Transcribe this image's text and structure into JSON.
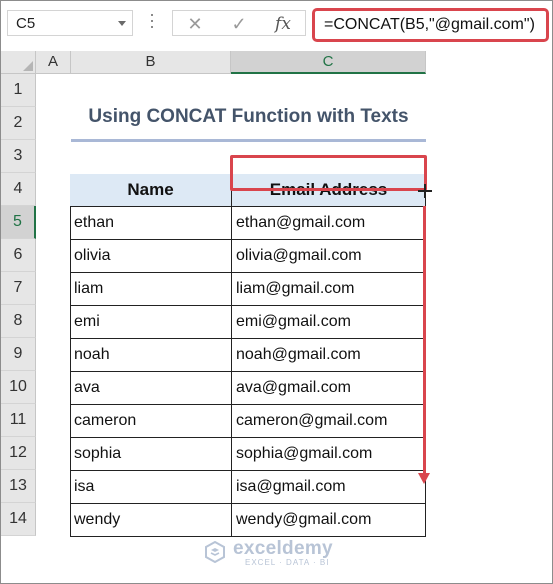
{
  "formula_bar": {
    "name_box": "C5",
    "cancel_icon": "✕",
    "enter_icon": "✓",
    "fx_label": "fx",
    "formula": "=CONCAT(B5,\"@gmail.com\")"
  },
  "columns": [
    "A",
    "B",
    "C"
  ],
  "rows": [
    "1",
    "2",
    "3",
    "4",
    "5",
    "6",
    "7",
    "8",
    "9",
    "10",
    "11",
    "12",
    "13",
    "14"
  ],
  "selected": {
    "column": "C",
    "row": "5"
  },
  "title": "Using CONCAT Function with Texts",
  "table": {
    "headers": [
      "Name",
      "Email Address"
    ],
    "rows": [
      [
        "ethan",
        "ethan@gmail.com"
      ],
      [
        "olivia",
        "olivia@gmail.com"
      ],
      [
        "liam",
        "liam@gmail.com"
      ],
      [
        "emi",
        "emi@gmail.com"
      ],
      [
        "noah",
        "noah@gmail.com"
      ],
      [
        "ava",
        "ava@gmail.com"
      ],
      [
        "cameron",
        "cameron@gmail.com"
      ],
      [
        "sophia",
        "sophia@gmail.com"
      ],
      [
        "isa",
        "isa@gmail.com"
      ],
      [
        "wendy",
        "wendy@gmail.com"
      ]
    ]
  },
  "watermark": {
    "name": "exceldemy",
    "tagline": "EXCEL · DATA · BI"
  },
  "colors": {
    "highlight": "#d9454d",
    "header_fill": "#dde9f5",
    "title": "#44546a",
    "excel_green": "#217346"
  }
}
